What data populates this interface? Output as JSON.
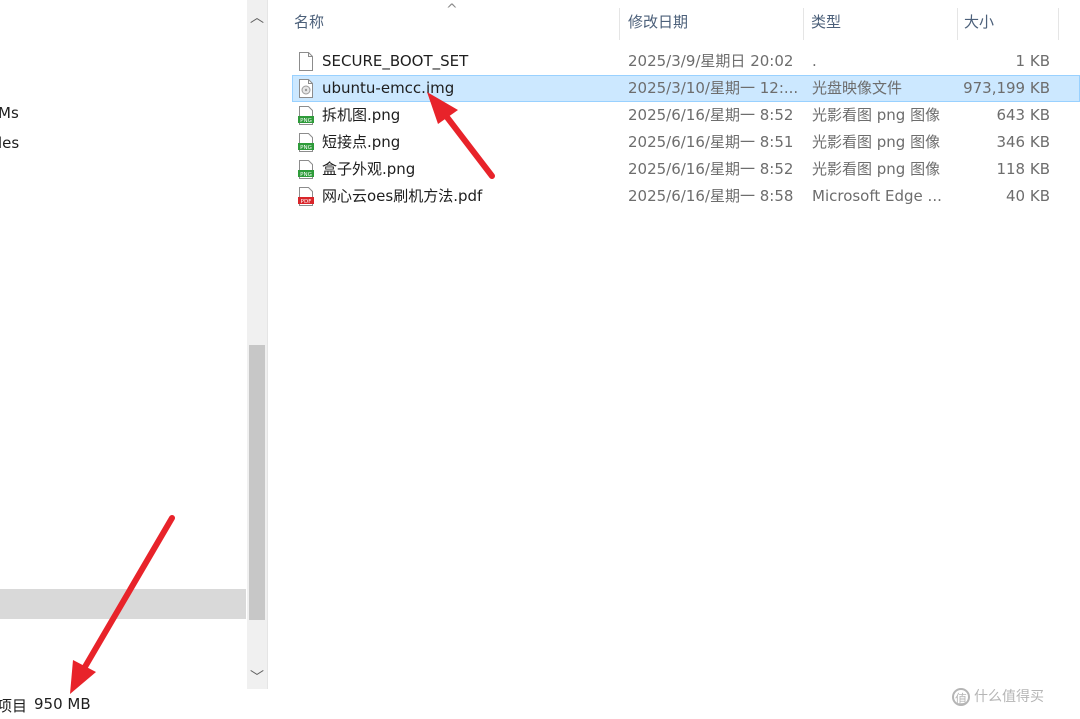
{
  "nav": {
    "items": [
      "Ms",
      "les"
    ]
  },
  "columns": {
    "name": "名称",
    "date": "修改日期",
    "type": "类型",
    "size": "大小"
  },
  "files": [
    {
      "name": "SECURE_BOOT_SET",
      "date": "2025/3/9/星期日 20:02",
      "type": ".",
      "size": "1 KB",
      "icon": "file-icon"
    },
    {
      "name": "ubuntu-emcc.img",
      "date": "2025/3/10/星期一 12:...",
      "type": "光盘映像文件",
      "size": "973,199 KB",
      "icon": "disc-image-icon"
    },
    {
      "name": "拆机图.png",
      "date": "2025/6/16/星期一 8:52",
      "type": "光影看图 png 图像",
      "size": "643 KB",
      "icon": "png-icon"
    },
    {
      "name": "短接点.png",
      "date": "2025/6/16/星期一 8:51",
      "type": "光影看图 png 图像",
      "size": "346 KB",
      "icon": "png-icon"
    },
    {
      "name": "盒子外观.png",
      "date": "2025/6/16/星期一 8:52",
      "type": "光影看图 png 图像",
      "size": "118 KB",
      "icon": "png-icon"
    },
    {
      "name": "网心云oes刷机方法.pdf",
      "date": "2025/6/16/星期一 8:58",
      "type": "Microsoft Edge ...",
      "size": "40 KB",
      "icon": "pdf-icon"
    }
  ],
  "status": {
    "items_label": "项目",
    "selected_size": "950 MB"
  },
  "watermark": {
    "text": "什么值得买",
    "icon_glyph": "值"
  },
  "icons": {
    "png_label": "PNG",
    "pdf_label": "PDF"
  },
  "colors": {
    "selection_bg": "#cce8ff",
    "selection_border": "#99d1ff",
    "header_text": "#4c607a",
    "annotation_arrow": "#e8232a"
  }
}
